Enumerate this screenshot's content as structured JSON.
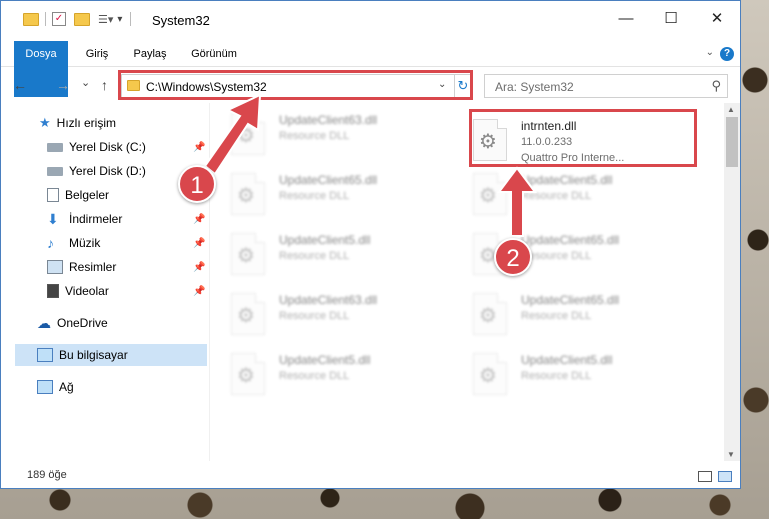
{
  "window": {
    "title": "System32",
    "controls": {
      "minimize": "—",
      "maximize": "☐",
      "close": "✕"
    }
  },
  "ribbon": {
    "tabs": [
      "Dosya",
      "Giriş",
      "Paylaş",
      "Görünüm"
    ],
    "help": "?"
  },
  "nav": {
    "back": "←",
    "forward": "→",
    "recent": "⌄",
    "up": "↑",
    "address": "C:\\Windows\\System32",
    "search_placeholder": "Ara: System32"
  },
  "sidebar": {
    "items": [
      {
        "label": "Hızlı erişim",
        "icon": "star-icon"
      },
      {
        "label": "Yerel Disk (C:)",
        "icon": "drive-icon",
        "pinned": true
      },
      {
        "label": "Yerel Disk (D:)",
        "icon": "drive-icon",
        "pinned": false
      },
      {
        "label": "Belgeler",
        "icon": "documents-icon",
        "pinned": true
      },
      {
        "label": "İndirmeler",
        "icon": "downloads-icon",
        "pinned": true
      },
      {
        "label": "Müzik",
        "icon": "music-icon",
        "pinned": true
      },
      {
        "label": "Resimler",
        "icon": "pictures-icon",
        "pinned": true
      },
      {
        "label": "Videolar",
        "icon": "videos-icon",
        "pinned": true
      },
      {
        "label": "OneDrive",
        "icon": "cloud-icon"
      },
      {
        "label": "Bu bilgisayar",
        "icon": "computer-icon",
        "selected": true
      },
      {
        "label": "Ağ",
        "icon": "network-icon"
      }
    ]
  },
  "files": {
    "highlighted": {
      "name": "intrnten.dll",
      "version": "11.0.0.233",
      "description": "Quattro Pro Interne..."
    },
    "left_column": [
      {
        "name": "UpdateClient63.dll",
        "type": "Resource DLL"
      },
      {
        "name": "UpdateClient65.dll",
        "type": "Resource DLL"
      },
      {
        "name": "UpdateClient5.dll",
        "type": "Resource DLL"
      },
      {
        "name": "UpdateClient63.dll",
        "type": "Resource DLL"
      },
      {
        "name": "UpdateClient5.dll",
        "type": "Resource DLL"
      }
    ],
    "right_column": [
      {
        "name": "UpdateClient5.dll",
        "type": "Resource DLL"
      },
      {
        "name": "UpdateClient65.dll",
        "type": "Resource DLL"
      },
      {
        "name": "UpdateClient65.dll",
        "type": "Resource DLL"
      },
      {
        "name": "UpdateClient5.dll",
        "type": "Resource DLL"
      }
    ]
  },
  "status": {
    "count": "189 öğe"
  },
  "annotations": {
    "step1": "1",
    "step2": "2",
    "color": "#d9474c"
  }
}
